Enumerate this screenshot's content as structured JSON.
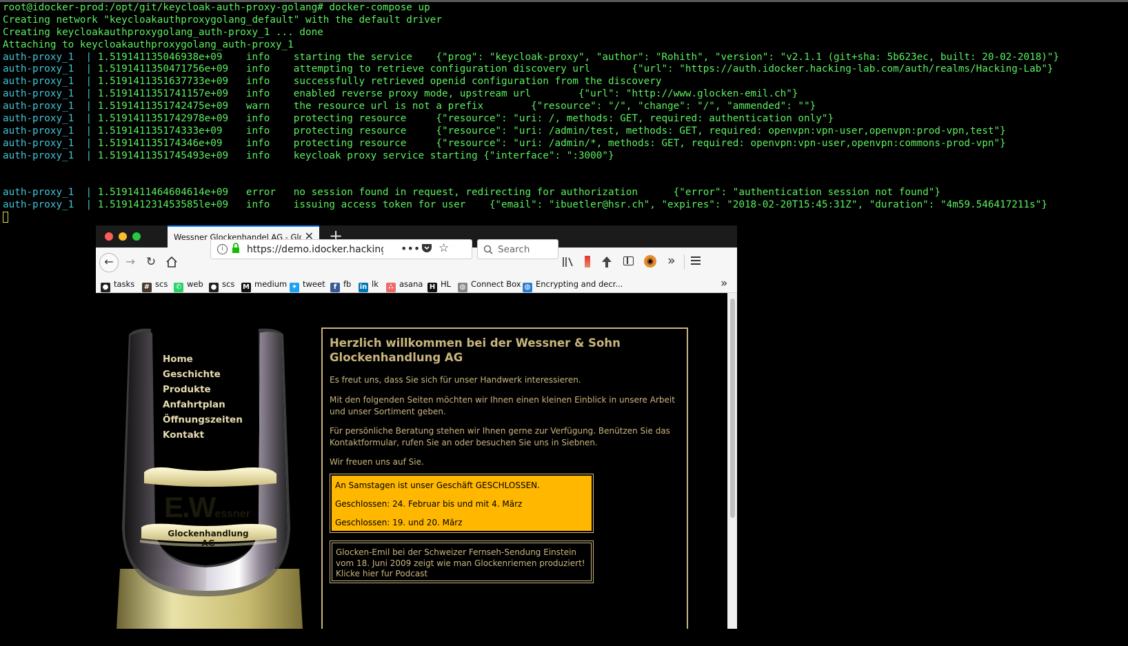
{
  "terminal": {
    "lines": [
      {
        "seg": [
          {
            "t": "root@idocker-prod:/opt/git/keycloak-auth-proxy-golang# docker-compose up",
            "c": "g"
          }
        ]
      },
      {
        "seg": [
          {
            "t": "Creating network \"keycloakauthproxygolang_default\" with the default driver",
            "c": "g"
          }
        ]
      },
      {
        "seg": [
          {
            "t": "Creating keycloakauthproxygolang_auth-proxy_1 ... ",
            "c": "g"
          },
          {
            "t": "done",
            "c": "g"
          }
        ]
      },
      {
        "seg": [
          {
            "t": "Attaching to keycloakauthproxygolang_auth-proxy_1",
            "c": "g"
          }
        ]
      },
      {
        "seg": [
          {
            "t": "auth-proxy_1  ",
            "c": "c"
          },
          {
            "t": "| ",
            "c": "c"
          },
          {
            "t": "1.519141135046938e+09    info    starting the service    {\"prog\": \"keycloak-proxy\", \"author\": \"Rohith\", \"version\": \"v2.1.1 (git+sha: 5b623ec, built: 20-02-2018)\"}",
            "c": "g"
          }
        ]
      },
      {
        "seg": [
          {
            "t": "auth-proxy_1  ",
            "c": "c"
          },
          {
            "t": "| ",
            "c": "c"
          },
          {
            "t": "1.5191411350471756e+09   info    attempting to retrieve configuration discovery url       {\"url\": \"https://auth.idocker.hacking-lab.com/auth/realms/Hacking-Lab\"}",
            "c": "g"
          }
        ]
      },
      {
        "seg": [
          {
            "t": "auth-proxy_1  ",
            "c": "c"
          },
          {
            "t": "| ",
            "c": "c"
          },
          {
            "t": "1.5191411351637733e+09   info    successfully retrieved openid configuration from the discovery",
            "c": "g"
          }
        ]
      },
      {
        "seg": [
          {
            "t": "auth-proxy_1  ",
            "c": "c"
          },
          {
            "t": "| ",
            "c": "c"
          },
          {
            "t": "1.5191411351741157e+09   info    enabled reverse proxy mode, upstream url        {\"url\": \"http://www.glocken-emil.ch\"}",
            "c": "g"
          }
        ]
      },
      {
        "seg": [
          {
            "t": "auth-proxy_1  ",
            "c": "c"
          },
          {
            "t": "| ",
            "c": "c"
          },
          {
            "t": "1.5191411351742475e+09   warn    the resource url is not a prefix        {\"resource\": \"/\", \"change\": \"/\", \"ammended\": \"\"}",
            "c": "g"
          }
        ]
      },
      {
        "seg": [
          {
            "t": "auth-proxy_1  ",
            "c": "c"
          },
          {
            "t": "| ",
            "c": "c"
          },
          {
            "t": "1.5191411351742978e+09   info    protecting resource     {\"resource\": \"uri: /, methods: GET, required: authentication only\"}",
            "c": "g"
          }
        ]
      },
      {
        "seg": [
          {
            "t": "auth-proxy_1  ",
            "c": "c"
          },
          {
            "t": "| ",
            "c": "c"
          },
          {
            "t": "1.519141135174333e+09    info    protecting resource     {\"resource\": \"uri: /admin/test, methods: GET, required: openvpn:vpn-user,openvpn:prod-vpn,test\"}",
            "c": "g"
          }
        ]
      },
      {
        "seg": [
          {
            "t": "auth-proxy_1  ",
            "c": "c"
          },
          {
            "t": "| ",
            "c": "c"
          },
          {
            "t": "1.519141135174346e+09    info    protecting resource     {\"resource\": \"uri: /admin/*, methods: GET, required: openvpn:vpn-user,openvpn:commons-prod-vpn\"}",
            "c": "g"
          }
        ]
      },
      {
        "seg": [
          {
            "t": "auth-proxy_1  ",
            "c": "c"
          },
          {
            "t": "| ",
            "c": "c"
          },
          {
            "t": "1.5191411351745493e+09   info    keycloak proxy service starting {\"interface\": \":3000\"}",
            "c": "g"
          }
        ]
      },
      {
        "seg": [
          {
            "t": " ",
            "c": "g"
          }
        ]
      },
      {
        "seg": [
          {
            "t": " ",
            "c": "g"
          }
        ]
      },
      {
        "seg": [
          {
            "t": "auth-proxy_1  ",
            "c": "c"
          },
          {
            "t": "| ",
            "c": "c"
          },
          {
            "t": "1.5191411464604614e+09   error   no session found in request, redirecting for authorization      {\"error\": \"authentication session not found\"}",
            "c": "g"
          }
        ]
      },
      {
        "seg": [
          {
            "t": "auth-proxy_1  ",
            "c": "c"
          },
          {
            "t": "| ",
            "c": "c"
          },
          {
            "t": "1.519141231453585le+09   info    issuing access token for user    {\"email\": \"ibuetler@hsr.ch\", \"expires\": \"2018-02-20T15:45:31Z\", \"duration\": \"4m59.546417211s\"}",
            "c": "g"
          }
        ]
      }
    ]
  },
  "browser": {
    "tab_title": "Wessner Glockenhandel AG - Glocken",
    "url": "https://demo.idocker.hacking-l",
    "search_placeholder": "Search",
    "bookmarks": [
      {
        "label": "tasks",
        "icon": "github-icon",
        "color": "#222222"
      },
      {
        "label": "scs",
        "icon": "hash-icon",
        "color": "#4a3a2a"
      },
      {
        "label": "web",
        "icon": "whatsapp-icon",
        "color": "#25d366"
      },
      {
        "label": "scs",
        "icon": "github-icon",
        "color": "#222222"
      },
      {
        "label": "medium",
        "icon": "medium-icon",
        "color": "#111111"
      },
      {
        "label": "tweet",
        "icon": "twitter-icon",
        "color": "#1da1f2"
      },
      {
        "label": "fb",
        "icon": "facebook-icon",
        "color": "#3b5998"
      },
      {
        "label": "lk",
        "icon": "linkedin-icon",
        "color": "#0077b5"
      },
      {
        "label": "asana",
        "icon": "asana-icon",
        "color": "#f06a6a"
      },
      {
        "label": "HL",
        "icon": "hl-icon",
        "color": "#111111"
      },
      {
        "label": "Connect Box",
        "icon": "globe-icon",
        "color": "#888888"
      },
      {
        "label": "Encrypting and decr...",
        "icon": "globe-icon",
        "color": "#2a7fd4"
      }
    ]
  },
  "website": {
    "nav": [
      "Home",
      "Geschichte",
      "Produkte",
      "Anfahrtplan",
      "Öffnungszeiten",
      "Kontakt"
    ],
    "logo_initials": "E.W",
    "logo_name": "essner",
    "logo_sub": "Glockenhandlung AG",
    "title": "Herzlich willkommen bei der Wessner & Sohn Glockenhandlung AG",
    "paragraphs": [
      "Es freut uns, dass Sie sich für unser Handwerk interessieren.",
      "Mit den folgenden Seiten möchten wir Ihnen einen kleinen Einblick in unsere Arbeit und unser Sortiment geben.",
      "Für persönliche Beratung stehen wir Ihnen gerne zur Verfügung. Benützen Sie das Kontaktformular, rufen Sie an oder besuchen Sie uns in Siebnen.",
      "Wir freuen uns auf Sie."
    ],
    "notice": [
      "An Samstagen ist unser Geschäft GESCHLOSSEN.",
      "Geschlossen: 24. Februar bis und mit 4. März",
      "Geschlossen: 19. und 20. März"
    ],
    "podcast": "Glocken-Emil bei der Schweizer Fernseh-Sendung Einstein vom 18. Juni 2009 zeigt wie man Glockenriemen produziert! Klicke hier fur Podcast"
  },
  "colors": {
    "terminal_green": "#5cf060",
    "terminal_cyan": "#41c4d6",
    "gold": "#c9b67e",
    "notice_bg": "#ffb700",
    "tab_accent": "#0a84ff"
  }
}
